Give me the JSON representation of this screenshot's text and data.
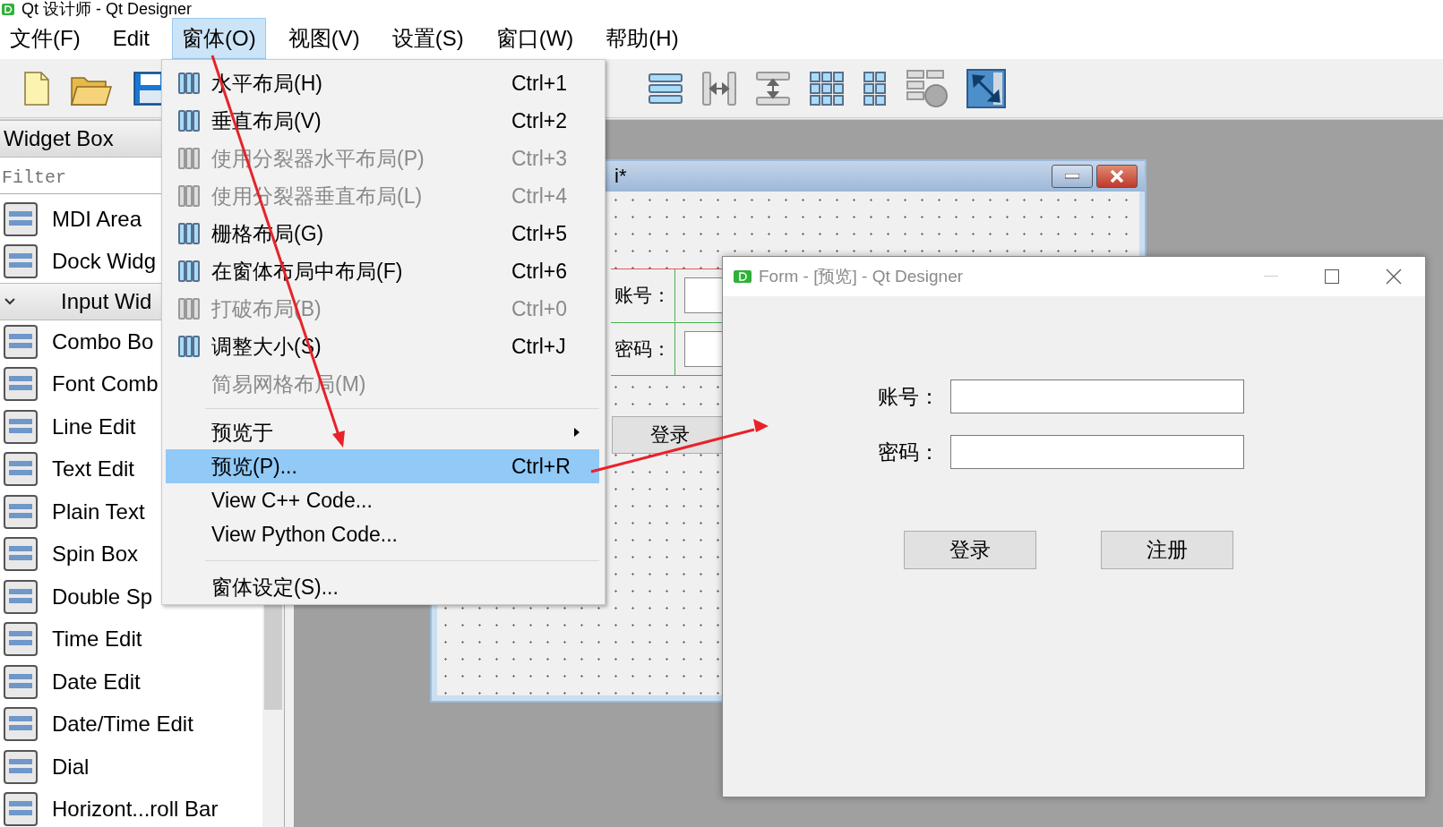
{
  "window": {
    "title": "Qt 设计师 - Qt Designer"
  },
  "menubar": [
    {
      "label": "文件(F)",
      "selected": false
    },
    {
      "label": "Edit",
      "selected": false
    },
    {
      "label": "窗体(O)",
      "selected": true
    },
    {
      "label": "视图(V)",
      "selected": false
    },
    {
      "label": "设置(S)",
      "selected": false
    },
    {
      "label": "窗口(W)",
      "selected": false
    },
    {
      "label": "帮助(H)",
      "selected": false
    }
  ],
  "widget_box": {
    "title": "Widget Box",
    "filter": {
      "placeholder": "Filter"
    },
    "items": [
      {
        "kind": "widget",
        "label": "MDI Area"
      },
      {
        "kind": "widget",
        "label": "Dock Widg"
      },
      {
        "kind": "category",
        "label": "Input Wid",
        "expanded": true
      },
      {
        "kind": "widget",
        "label": "Combo Bo"
      },
      {
        "kind": "widget",
        "label": "Font Comb"
      },
      {
        "kind": "widget",
        "label": "Line Edit"
      },
      {
        "kind": "widget",
        "label": "Text Edit"
      },
      {
        "kind": "widget",
        "label": "Plain Text"
      },
      {
        "kind": "widget",
        "label": "Spin Box"
      },
      {
        "kind": "widget",
        "label": "Double Sp"
      },
      {
        "kind": "widget",
        "label": "Time Edit"
      },
      {
        "kind": "widget",
        "label": "Date Edit"
      },
      {
        "kind": "widget",
        "label": "Date/Time Edit"
      },
      {
        "kind": "widget",
        "label": "Dial"
      },
      {
        "kind": "widget",
        "label": "Horizont...roll Bar"
      }
    ]
  },
  "form_window": {
    "title": "i*",
    "labels": [
      "账号：",
      "密码："
    ],
    "button": "登录"
  },
  "menu": [
    {
      "kind": "action",
      "label": "水平布局(H)",
      "shortcut": "Ctrl+1",
      "icon": true,
      "disabled": false,
      "selected": false
    },
    {
      "kind": "action",
      "label": "垂直布局(V)",
      "shortcut": "Ctrl+2",
      "icon": true,
      "disabled": false,
      "selected": false
    },
    {
      "kind": "action",
      "label": "使用分裂器水平布局(P)",
      "shortcut": "Ctrl+3",
      "icon": true,
      "disabled": true,
      "selected": false
    },
    {
      "kind": "action",
      "label": "使用分裂器垂直布局(L)",
      "shortcut": "Ctrl+4",
      "icon": true,
      "disabled": true,
      "selected": false
    },
    {
      "kind": "action",
      "label": "栅格布局(G)",
      "shortcut": "Ctrl+5",
      "icon": true,
      "disabled": false,
      "selected": false
    },
    {
      "kind": "action",
      "label": "在窗体布局中布局(F)",
      "shortcut": "Ctrl+6",
      "icon": true,
      "disabled": false,
      "selected": false
    },
    {
      "kind": "action",
      "label": "打破布局(B)",
      "shortcut": "Ctrl+0",
      "icon": true,
      "disabled": true,
      "selected": false
    },
    {
      "kind": "action",
      "label": "调整大小(S)",
      "shortcut": "Ctrl+J",
      "icon": true,
      "disabled": false,
      "selected": false
    },
    {
      "kind": "action",
      "label": "简易网格布局(M)",
      "icon": false,
      "disabled": true,
      "selected": false
    },
    {
      "kind": "separator"
    },
    {
      "kind": "submenu",
      "label": "预览于",
      "disabled": false,
      "selected": false
    },
    {
      "kind": "action",
      "label": "预览(P)...",
      "shortcut": "Ctrl+R",
      "icon": false,
      "disabled": false,
      "selected": true
    },
    {
      "kind": "action",
      "label": "View C++ Code...",
      "icon": false,
      "disabled": false,
      "selected": false
    },
    {
      "kind": "action",
      "label": "View Python Code...",
      "icon": false,
      "disabled": false,
      "selected": false
    },
    {
      "kind": "separator"
    },
    {
      "kind": "action",
      "label": "窗体设定(S)...",
      "icon": false,
      "disabled": false,
      "selected": false
    }
  ],
  "preview_window": {
    "title": "Form - [预览] - Qt Designer",
    "fields": [
      {
        "label": "账号："
      },
      {
        "label": "密码："
      }
    ],
    "buttons": [
      "登录",
      "注册"
    ]
  }
}
